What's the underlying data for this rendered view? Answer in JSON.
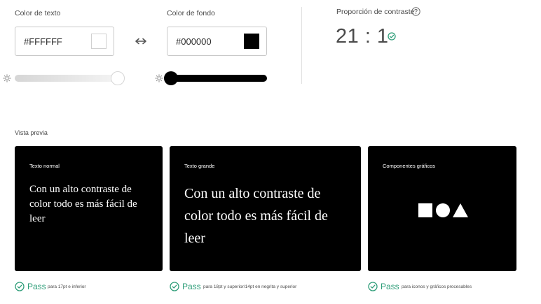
{
  "text_color": {
    "label": "Color de texto",
    "value": "#FFFFFF",
    "swatch": "#ffffff",
    "slider_level": 1.0
  },
  "bg_color": {
    "label": "Color de fondo",
    "value": "#000000",
    "swatch": "#000000",
    "slider_level": 0.0
  },
  "contrast": {
    "label": "Proporción de contraste",
    "value": "21 : 1"
  },
  "preview": {
    "label": "Vista previa",
    "cards": [
      {
        "title": "Texto normal",
        "sample": "Con un alto contraste de color todo es más fácil de leer",
        "pass_label": "Pass",
        "pass_desc": "para 17pt e inferior"
      },
      {
        "title": "Texto grande",
        "sample": "Con un alto contraste de color todo es más fácil de leer",
        "pass_label": "Pass",
        "pass_desc": "para 18pt y superior/14pt en negrita y superior"
      },
      {
        "title": "Componentes gráficos",
        "pass_label": "Pass",
        "pass_desc": "para iconos y gráficos procesables"
      }
    ]
  },
  "colors": {
    "pass": "#2d9d78",
    "card_bg": "#000000",
    "slider_white": "#e6e6e6",
    "slider_black": "#000000"
  }
}
